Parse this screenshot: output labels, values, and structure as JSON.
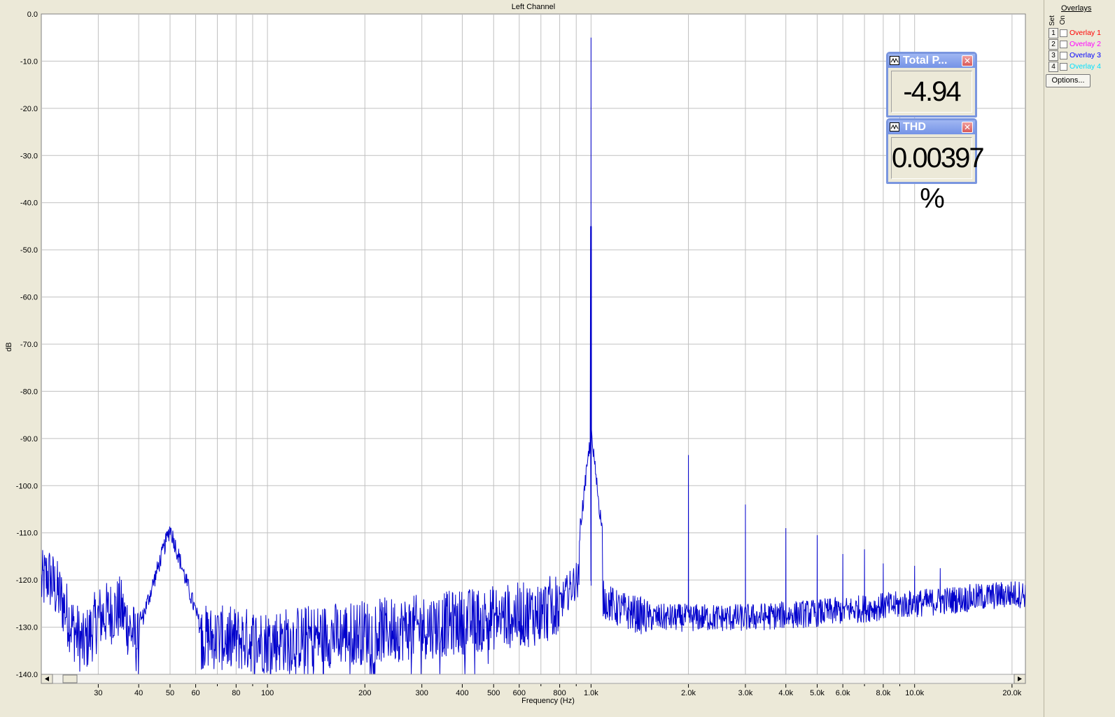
{
  "chart_data": {
    "type": "line",
    "title": "Left Channel",
    "xlabel": "Frequency (Hz)",
    "ylabel": "dB",
    "x_scale": "log",
    "xlim": [
      20,
      22000
    ],
    "ylim": [
      -140,
      0
    ],
    "grid": true,
    "y_ticks": [
      0,
      -10,
      -20,
      -30,
      -40,
      -50,
      -60,
      -70,
      -80,
      -90,
      -100,
      -110,
      -120,
      -130,
      -140
    ],
    "y_tick_labels": [
      "0.0",
      "-10.0",
      "-20.0",
      "-30.0",
      "-40.0",
      "-50.0",
      "-60.0",
      "-70.0",
      "-80.0",
      "-90.0",
      "-100.0",
      "-110.0",
      "-120.0",
      "-130.0",
      "-140.0"
    ],
    "x_ticks": [
      30,
      40,
      50,
      60,
      80,
      100,
      200,
      300,
      400,
      500,
      600,
      800,
      1000,
      2000,
      3000,
      4000,
      5000,
      6000,
      8000,
      10000,
      20000
    ],
    "x_tick_labels": [
      "30",
      "40",
      "50",
      "60",
      "80",
      "100",
      "200",
      "300",
      "400",
      "500",
      "600",
      "800",
      "1.0k",
      "2.0k",
      "3.0k",
      "4.0k",
      "5.0k",
      "6.0k",
      "8.0k",
      "10.0k",
      "20.0k"
    ],
    "x_minor_ticks": [
      70,
      90,
      700,
      900,
      7000,
      9000
    ],
    "line_color": "#0000CC",
    "noise_floor": [
      [
        20,
        -121
      ],
      [
        21,
        -119
      ],
      [
        23,
        -124
      ],
      [
        25,
        -130
      ],
      [
        27,
        -134
      ],
      [
        30,
        -128
      ],
      [
        35,
        -126
      ],
      [
        40,
        -134
      ],
      [
        45,
        -130
      ],
      [
        48,
        -125
      ],
      [
        60,
        -132
      ],
      [
        100,
        -133
      ],
      [
        200,
        -131
      ],
      [
        300,
        -130
      ],
      [
        500,
        -128
      ],
      [
        700,
        -127
      ],
      [
        800,
        -125
      ],
      [
        900,
        -120
      ],
      [
        1200,
        -126
      ],
      [
        1500,
        -128
      ],
      [
        3000,
        -128
      ],
      [
        5000,
        -127
      ],
      [
        10000,
        -125
      ],
      [
        20000,
        -123
      ],
      [
        22000,
        -123
      ]
    ],
    "peaks": [
      {
        "x": 1000,
        "y": -5
      },
      {
        "x": 2000,
        "y": -93.5
      },
      {
        "x": 3000,
        "y": -104
      },
      {
        "x": 4000,
        "y": -109
      },
      {
        "x": 5000,
        "y": -110.5
      },
      {
        "x": 6000,
        "y": -114.5
      },
      {
        "x": 7000,
        "y": -113.5
      },
      {
        "x": 8000,
        "y": -116.5
      },
      {
        "x": 10000,
        "y": -117
      },
      {
        "x": 12000,
        "y": -117.5
      }
    ],
    "bumps": [
      {
        "x": 50,
        "y": -109,
        "width": 0.08
      },
      {
        "x": 1000,
        "y": -89,
        "width": 0.03
      }
    ]
  },
  "overlays": {
    "title": "Overlays",
    "col_set": "Set",
    "col_on": "On",
    "items": [
      {
        "num": "1",
        "label": "Overlay 1",
        "color": "#FF0000"
      },
      {
        "num": "2",
        "label": "Overlay 2",
        "color": "#FF00FF"
      },
      {
        "num": "3",
        "label": "Overlay 3",
        "color": "#0000FF"
      },
      {
        "num": "4",
        "label": "Overlay 4",
        "color": "#00E0FF"
      }
    ],
    "options_label": "Options..."
  },
  "readouts": {
    "total_power": {
      "title": "Total P...",
      "value": "-4.94 dB"
    },
    "thd": {
      "title": "THD",
      "value": "0.00397 %"
    }
  },
  "colors": {
    "plot_bg": "#FFFFFF",
    "grid": "#C0C0C0",
    "window_bg": "#ECE9D8",
    "titlebar": "#7A96DF"
  }
}
